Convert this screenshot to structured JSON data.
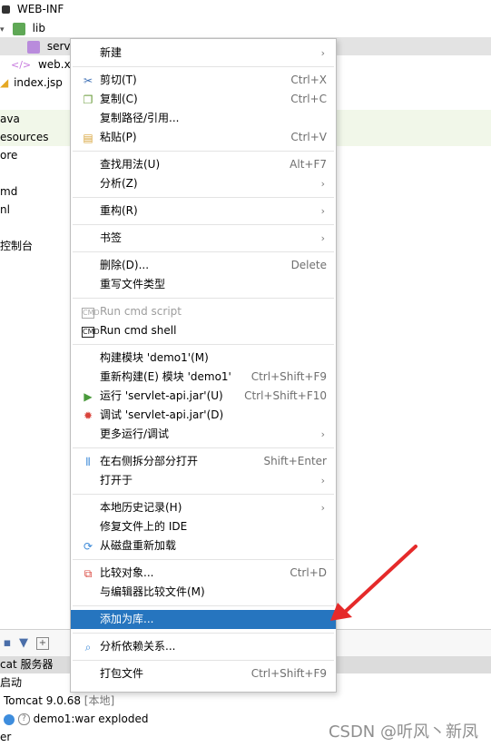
{
  "tree": [
    {
      "label": "WEB-INF",
      "indent": 0
    },
    {
      "label": "lib",
      "indent": 1
    },
    {
      "label": "servle",
      "indent": 3
    },
    {
      "label": "web.xml",
      "indent": 2
    },
    {
      "label": "index.jsp",
      "indent": 1
    },
    {
      "label": "ava",
      "indent": 0
    },
    {
      "label": "esources",
      "indent": 0
    },
    {
      "label": "ore",
      "indent": 0
    },
    {
      "label": "md",
      "indent": 0
    },
    {
      "label": "nl",
      "indent": 0
    },
    {
      "label": "控制台",
      "indent": 0
    }
  ],
  "menu": {
    "new": "新建",
    "cut": "剪切(T)",
    "cut_sc": "Ctrl+X",
    "copy": "复制(C)",
    "copy_sc": "Ctrl+C",
    "copy_path": "复制路径/引用...",
    "paste": "粘贴(P)",
    "paste_sc": "Ctrl+V",
    "find_usages": "查找用法(U)",
    "find_usages_sc": "Alt+F7",
    "analyze": "分析(Z)",
    "refactor": "重构(R)",
    "bookmarks": "书签",
    "delete": "删除(D)...",
    "delete_sc": "Delete",
    "override_type": "重写文件类型",
    "run_cmd_script": "Run cmd script",
    "run_cmd_shell": "Run cmd shell",
    "build_module": "构建模块 'demo1'(M)",
    "rebuild_module": "重新构建(E) 模块 'demo1'",
    "rebuild_sc": "Ctrl+Shift+F9",
    "run": "运行 'servlet-api.jar'(U)",
    "run_sc": "Ctrl+Shift+F10",
    "debug": "调试 'servlet-api.jar'(D)",
    "more_run": "更多运行/调试",
    "open_right": "在右侧拆分部分打开",
    "open_right_sc": "Shift+Enter",
    "open_in": "打开于",
    "local_history": "本地历史记录(H)",
    "repair_ide": "修复文件上的 IDE",
    "reload": "从磁盘重新加载",
    "compare": "比较对象...",
    "compare_sc": "Ctrl+D",
    "compare_editor": "与编辑器比较文件(M)",
    "add_library": "添加为库...",
    "analyze_deps": "分析依赖关系...",
    "package_file": "打包文件",
    "package_sc": "Ctrl+Shift+F9"
  },
  "services": {
    "header": "cat 服务器",
    "rows": [
      "启动",
      "Tomcat 9.0.68",
      "[本地]",
      "demo1:war exploded",
      "er"
    ]
  },
  "watermark": "CSDN @听风丶新凤",
  "colors": {
    "highlight": "#2675bf",
    "annotation": "#e52a2a"
  }
}
